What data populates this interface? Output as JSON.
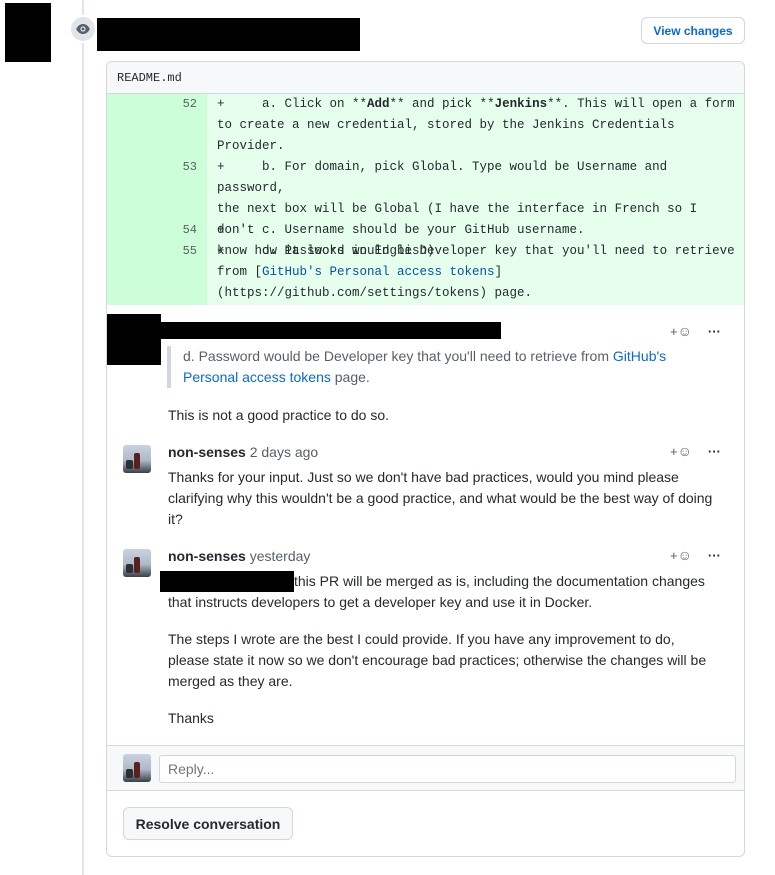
{
  "header": {
    "view_changes_label": "View changes",
    "eye_icon": "eye-icon"
  },
  "file": {
    "name": "README.md"
  },
  "diff_lines": [
    {
      "num": "52",
      "text_prefix": "+     a. Click on **",
      "b1": "Add",
      "mid": "** and pick **",
      "b2": "Jenkins",
      "text_suffix": "**. This will open a form\nto create a new credential, stored by the Jenkins Credentials\nProvider."
    },
    {
      "num": "53",
      "text": "+     b. For domain, pick Global. Type would be Username and password,\nthe next box will be Global (I have the interface in French so I don't\nknow how it looks in English)"
    },
    {
      "num": "54",
      "text": "+     c. Username should be your GitHub username."
    },
    {
      "num": "55",
      "text_prefix": "+     d. Password would be Developer key that you'll need to retrieve\nfrom [",
      "link": "GitHub's Personal access tokens",
      "text_suffix": "]\n(https://github.com/settings/tokens) page."
    }
  ],
  "thread": {
    "first_comment": {
      "quote_prefix": "d. Password would be Developer key that you'll need to retrieve from ",
      "quote_link": "GitHub's Personal access tokens",
      "quote_suffix": " page.",
      "body": "This is not a good practice to do so."
    },
    "comments": [
      {
        "author": "non-senses",
        "time": "2 days ago",
        "body": "Thanks for your input. Just so we don't have bad practices, would you mind please clarifying why this wouldn't be a good practice, and what would be the best way of doing it?"
      },
      {
        "author": "non-senses",
        "time": "yesterday",
        "body_p1": "this PR will be merged as is, including the documentation changes that instructs developers to get a developer key and use it in Docker.",
        "body_p2": "The steps I wrote are the best I could provide. If you have any improvement to do, please state it now so we don't encourage bad practices; otherwise the changes will be merged as they are.",
        "body_p3": "Thanks"
      }
    ],
    "reaction_plus": "+",
    "more": "···"
  },
  "reply": {
    "placeholder": "Reply..."
  },
  "resolve_label": "Resolve conversation",
  "colors": {
    "link": "#0969da",
    "diff_add_bg": "#e6ffec",
    "diff_gutter_bg": "#ccffd8"
  }
}
